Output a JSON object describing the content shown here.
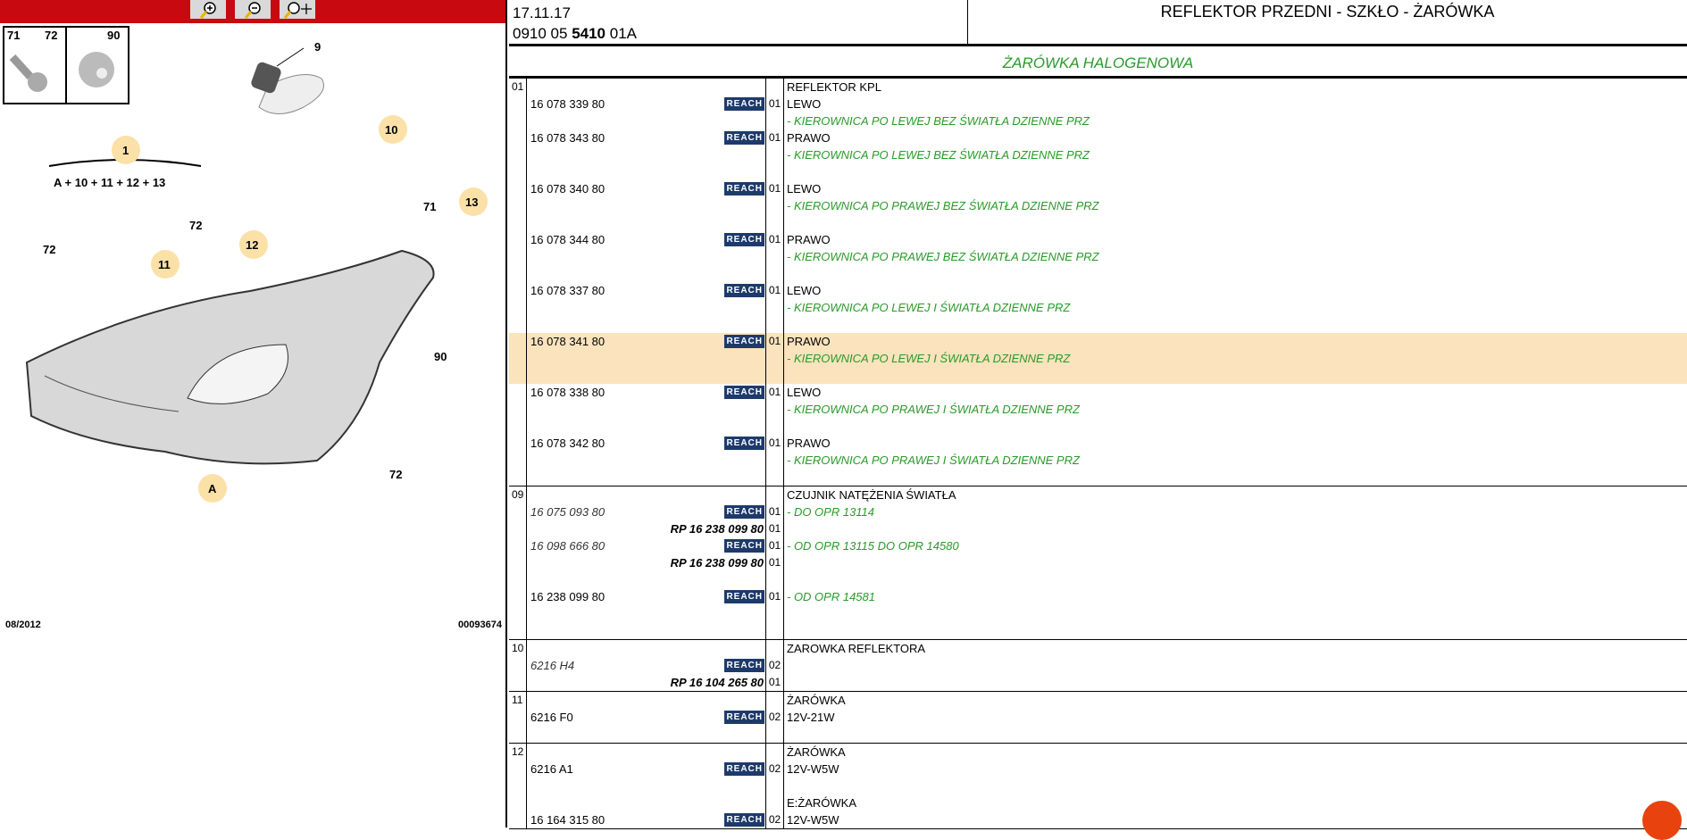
{
  "toolbar": {
    "buttons": [
      {
        "name": "zoom-in-button",
        "icon": "zoom-in-icon"
      },
      {
        "name": "zoom-out-button",
        "icon": "zoom-out-icon"
      },
      {
        "name": "zoom-pan-button",
        "icon": "zoom-pan-icon"
      }
    ]
  },
  "diagram": {
    "inset_labels": [
      "71",
      "72",
      "90"
    ],
    "callouts": [
      "9",
      "10",
      "1",
      "11",
      "12",
      "13",
      "A"
    ],
    "assembly_formula": "A + 10 + 11 + 12 + 13",
    "plain_labels": [
      "72",
      "72",
      "72",
      "71",
      "90",
      "72"
    ],
    "date": "08/2012",
    "ref": "00093674"
  },
  "header": {
    "date": "17.11.17",
    "code_pre": "0910 05 ",
    "code_bold": "5410",
    "code_post": " 01A",
    "title": "REFLEKTOR PRZEDNI - SZKŁO - ŻARÓWKA"
  },
  "subtitle": "ŻARÓWKA HALOGENOWA",
  "groups": [
    {
      "num": "01",
      "lines": [
        {
          "desc": "REFLEKTOR KPL",
          "ds": "title"
        },
        {
          "part": "16 078 339 80",
          "reach": true,
          "qty": "01",
          "desc": "LEWO"
        },
        {
          "desc": "- KIEROWNICA PO LEWEJ BEZ ŚWIATŁA DZIENNE PRZ",
          "ds": "green"
        },
        {
          "part": "16 078 343 80",
          "reach": true,
          "qty": "01",
          "desc": "PRAWO"
        },
        {
          "desc": "- KIEROWNICA PO LEWEJ BEZ ŚWIATŁA DZIENNE PRZ",
          "ds": "green"
        },
        {},
        {
          "part": "16 078 340 80",
          "reach": true,
          "qty": "01",
          "desc": "LEWO"
        },
        {
          "desc": "- KIEROWNICA PO PRAWEJ BEZ ŚWIATŁA DZIENNE PRZ",
          "ds": "green"
        },
        {},
        {
          "part": "16 078 344 80",
          "reach": true,
          "qty": "01",
          "desc": "PRAWO"
        },
        {
          "desc": "- KIEROWNICA PO PRAWEJ BEZ ŚWIATŁA DZIENNE PRZ",
          "ds": "green"
        },
        {},
        {
          "part": "16 078 337 80",
          "reach": true,
          "qty": "01",
          "desc": "LEWO"
        },
        {
          "desc": "- KIEROWNICA PO LEWEJ I ŚWIATŁA DZIENNE PRZ",
          "ds": "green"
        },
        {},
        {
          "part": "16 078 341 80",
          "reach": true,
          "qty": "01",
          "desc": "PRAWO",
          "hl": true
        },
        {
          "desc": "- KIEROWNICA PO LEWEJ I ŚWIATŁA DZIENNE PRZ",
          "ds": "green",
          "hl": true
        },
        {
          "hl": true
        },
        {
          "part": "16 078 338 80",
          "reach": true,
          "qty": "01",
          "desc": "LEWO"
        },
        {
          "desc": "- KIEROWNICA PO PRAWEJ I ŚWIATŁA DZIENNE PRZ",
          "ds": "green"
        },
        {},
        {
          "part": "16 078 342 80",
          "reach": true,
          "qty": "01",
          "desc": "PRAWO"
        },
        {
          "desc": "- KIEROWNICA PO PRAWEJ I ŚWIATŁA DZIENNE PRZ",
          "ds": "green"
        },
        {}
      ]
    },
    {
      "num": "09",
      "lines": [
        {
          "desc": "CZUJNIK NATĘŻENIA ŚWIATŁA",
          "ds": "title"
        },
        {
          "part": "16 075 093 80",
          "ps": "italic",
          "reach": true,
          "qty": "01",
          "desc": "- DO OPR 13114",
          "ds": "green"
        },
        {
          "part": "RP 16 238 099 80",
          "ps": "rp",
          "qty": "01"
        },
        {
          "part": "16 098 666 80",
          "ps": "italic",
          "reach": true,
          "qty": "01",
          "desc": "- OD OPR 13115 DO OPR 14580",
          "ds": "green"
        },
        {
          "part": "RP 16 238 099 80",
          "ps": "rp",
          "qty": "01"
        },
        {},
        {
          "part": "16 238 099 80",
          "reach": true,
          "qty": "01",
          "desc": "- OD OPR 14581",
          "ds": "green"
        },
        {},
        {}
      ]
    },
    {
      "num": "10",
      "lines": [
        {
          "desc": "ZAROWKA REFLEKTORA",
          "ds": "title"
        },
        {
          "part": "6216 H4",
          "ps": "italic",
          "reach": true,
          "qty": "02"
        },
        {
          "part": "RP 16 104 265 80",
          "ps": "rp",
          "qty": "01"
        }
      ]
    },
    {
      "num": "11",
      "lines": [
        {
          "desc": "ŻARÓWKA",
          "ds": "title"
        },
        {
          "part": "6216 F0",
          "reach": true,
          "qty": "02",
          "desc": "12V-21W"
        },
        {}
      ]
    },
    {
      "num": "12",
      "lines": [
        {
          "desc": "ŻARÓWKA",
          "ds": "title"
        },
        {
          "part": "6216 A1",
          "reach": true,
          "qty": "02",
          "desc": "12V-W5W"
        },
        {},
        {
          "desc": "E:ŻARÓWKA",
          "ds": "title"
        },
        {
          "part": "16 164 315 80",
          "reach": true,
          "qty": "02",
          "desc": "12V-W5W"
        }
      ]
    }
  ],
  "reach_label": "REACH"
}
